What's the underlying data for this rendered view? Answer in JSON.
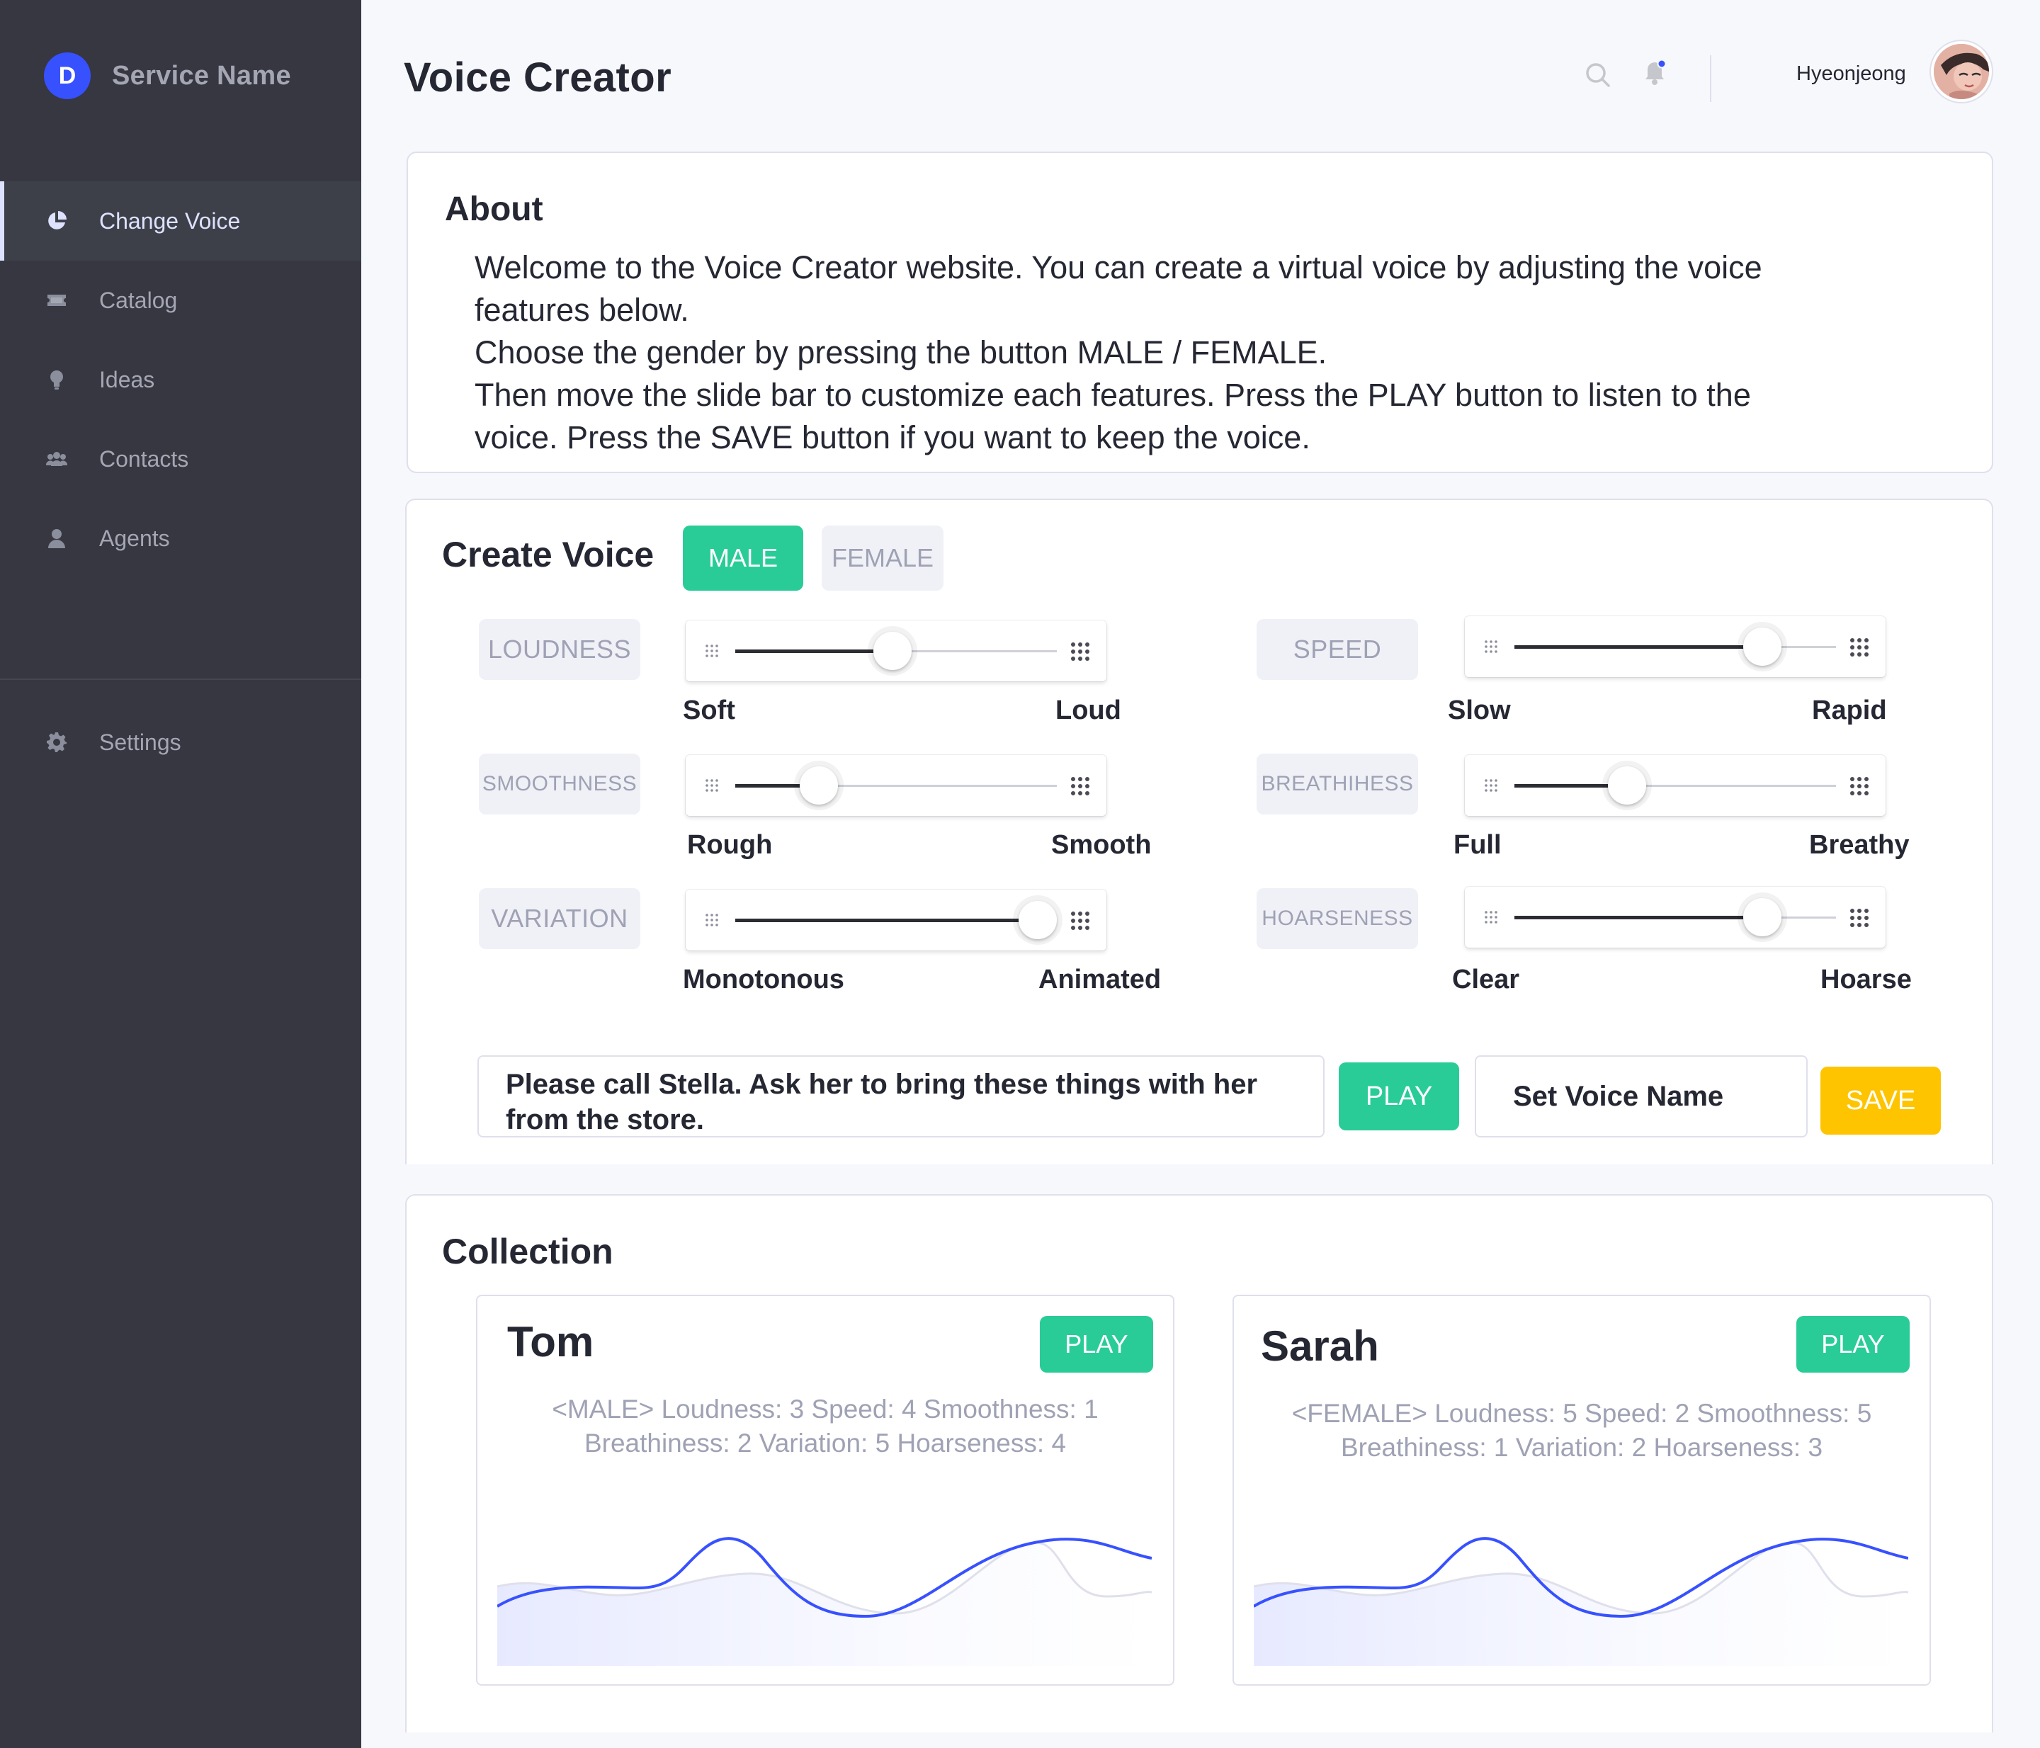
{
  "app": {
    "brand_letter": "D",
    "brand_name": "Service Name",
    "accent_color": "#3751ff",
    "green": "#29cc97",
    "yellow": "#fec400"
  },
  "sidebar": {
    "items": [
      {
        "label": "Change Voice",
        "icon": "pie-chart-icon",
        "active": true
      },
      {
        "label": "Catalog",
        "icon": "ticket-icon"
      },
      {
        "label": "Ideas",
        "icon": "lightbulb-icon"
      },
      {
        "label": "Contacts",
        "icon": "users-icon"
      },
      {
        "label": "Agents",
        "icon": "person-icon"
      }
    ],
    "settings": {
      "label": "Settings",
      "icon": "gear-icon"
    }
  },
  "header": {
    "title": "Voice Creator",
    "user_name": "Hyeonjeong",
    "has_notification": true
  },
  "about": {
    "title": "About",
    "lines": [
      "Welcome to the Voice Creator website. You can create a virtual voice by adjusting the voice",
      "features below.",
      "Choose the gender by pressing the button MALE / FEMALE.",
      "Then move the slide bar to customize each features. Press the PLAY button to listen to the",
      "voice. Press the SAVE button if you want to keep the voice."
    ]
  },
  "create": {
    "title": "Create Voice",
    "gender": {
      "male": "MALE",
      "female": "FEMALE",
      "selected": "MALE"
    },
    "features": [
      {
        "label": "LOUDNESS",
        "min": "Soft",
        "max": "Loud",
        "value": 0.49
      },
      {
        "label": "SPEED",
        "min": "Slow",
        "max": "Rapid",
        "value": 0.77
      },
      {
        "label": "SMOOTHNESS",
        "min": "Rough",
        "max": "Smooth",
        "value": 0.26
      },
      {
        "label": "BREATHIHESS",
        "min": "Full",
        "max": "Breathy",
        "value": 0.35
      },
      {
        "label": "VARIATION",
        "min": "Monotonous",
        "max": "Animated",
        "value": 0.94
      },
      {
        "label": "HOARSENESS",
        "min": "Clear",
        "max": "Hoarse",
        "value": 0.77
      }
    ],
    "sentence_line1": "Please call Stella. Ask her to bring these things with her",
    "sentence_line2": "from the store.",
    "play_label": "PLAY",
    "voice_name_placeholder": "Set Voice Name",
    "save_label": "SAVE"
  },
  "collection": {
    "title": "Collection",
    "voices": [
      {
        "name": "Tom",
        "play_label": "PLAY",
        "desc_line1": "<MALE> Loudness: 3 Speed: 4 Smoothness: 1",
        "desc_line2": "Breathiness: 2 Variation: 5 Hoarseness: 4"
      },
      {
        "name": "Sarah",
        "play_label": "PLAY",
        "desc_line1": "<FEMALE> Loudness: 5 Speed: 2 Smoothness: 5",
        "desc_line2": "Breathiness: 1 Variation: 2 Hoarseness: 3"
      }
    ]
  }
}
